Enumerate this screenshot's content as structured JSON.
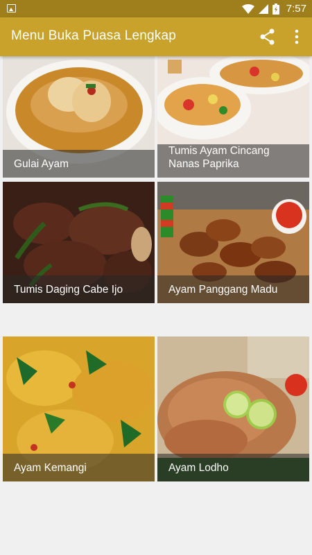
{
  "status_bar": {
    "time": "7:57"
  },
  "app_bar": {
    "title": "Menu Buka Puasa Lengkap",
    "share_icon": "share-icon",
    "more_icon": "more-vert-icon"
  },
  "menu": {
    "items": [
      {
        "label": "Gulai Ayam"
      },
      {
        "label": "Tumis Ayam Cincang Nanas Paprika"
      },
      {
        "label": "Tumis Daging Cabe Ijo"
      },
      {
        "label": "Ayam Panggang Madu"
      },
      {
        "label": "Ayam Kemangi"
      },
      {
        "label": "Ayam Lodho"
      }
    ]
  },
  "colors": {
    "status_bar": "#9e7f1b",
    "app_bar": "#c9a22b",
    "background": "#f0f0f0"
  }
}
